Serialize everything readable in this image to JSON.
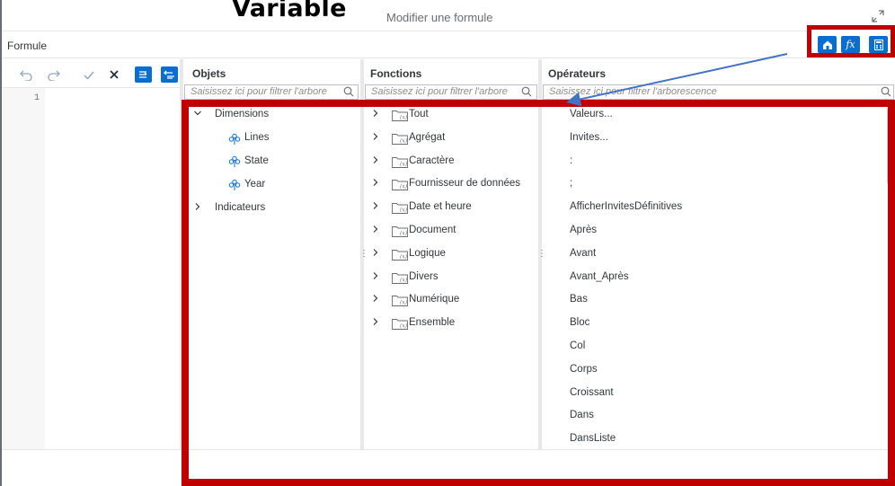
{
  "annotation_title": "Variable",
  "dialog": {
    "title": "Modifier une formule"
  },
  "formula_label": "Formule",
  "toolbar_right": [
    {
      "icon": "home-icon"
    },
    {
      "icon": "fx-icon",
      "label": "fx"
    },
    {
      "icon": "calculator-icon"
    }
  ],
  "editor": {
    "tools": [
      "undo-icon",
      "redo-icon",
      "validate-icon",
      "clear-icon",
      "format-icon",
      "unformat-icon"
    ],
    "line_numbers": [
      "1"
    ]
  },
  "objects": {
    "header": "Objets",
    "search_placeholder": "Saisissez ici pour filtrer l'arbore",
    "tree": [
      {
        "label": "Dimensions",
        "expanded": true,
        "children": [
          "Lines",
          "State",
          "Year"
        ]
      },
      {
        "label": "Indicateurs",
        "expanded": false
      }
    ]
  },
  "functions": {
    "header": "Fonctions",
    "search_placeholder": "Saisissez ici pour filtrer l'arbore",
    "items": [
      "Tout",
      "Agrégat",
      "Caractère",
      "Fournisseur de données",
      "Date et heure",
      "Document",
      "Logique",
      "Divers",
      "Numérique",
      "Ensemble"
    ]
  },
  "operators": {
    "header": "Opérateurs",
    "search_placeholder": "Saisissez ici pour filtrer l'arborescence",
    "items": [
      "Valeurs...",
      "Invites...",
      ":",
      ";",
      "AfficherInvitesDéfinitives",
      "Après",
      "Avant",
      "Avant_Après",
      "Bas",
      "Bloc",
      "Col",
      "Corps",
      "Croissant",
      "Dans",
      "DansListe"
    ]
  },
  "colors": {
    "accent": "#0a6ed1",
    "highlight": "#c00000",
    "arrow": "#4472c4"
  }
}
